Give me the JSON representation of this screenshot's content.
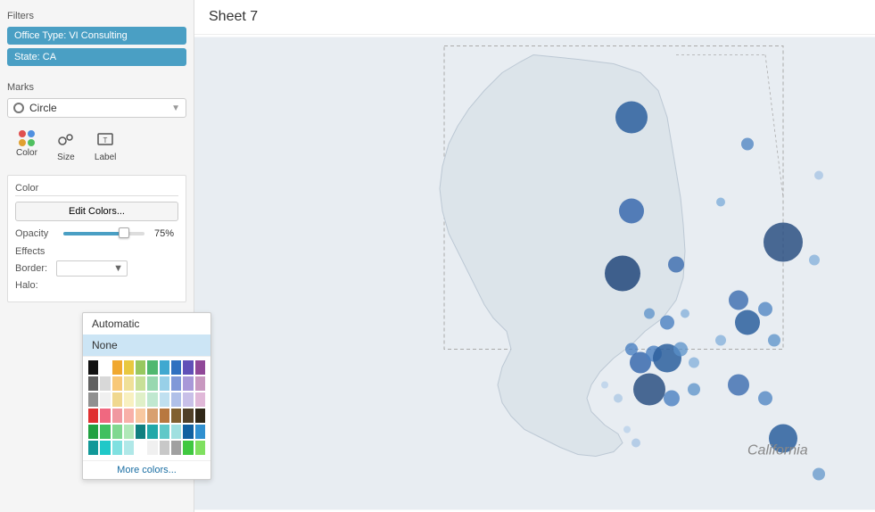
{
  "filters": {
    "label": "Filters",
    "chips": [
      {
        "id": "office-type",
        "text": "Office Type: VI Consulting"
      },
      {
        "id": "state",
        "text": "State: CA"
      }
    ]
  },
  "marks": {
    "label": "Marks",
    "dropdown": {
      "shape": "Circle"
    },
    "buttons": [
      {
        "id": "color",
        "label": "Color"
      },
      {
        "id": "size",
        "label": "Size"
      },
      {
        "id": "label",
        "label": "Label"
      }
    ]
  },
  "color_panel": {
    "title": "Color",
    "edit_button": "Edit Colors...",
    "opacity_label": "Opacity",
    "opacity_value": "75%",
    "effects_label": "Effects",
    "border_label": "Border:",
    "halo_label": "Halo:"
  },
  "halo_menu": {
    "items": [
      {
        "id": "automatic",
        "text": "Automatic"
      },
      {
        "id": "none",
        "text": "None",
        "selected": true
      }
    ],
    "more_colors": "More colors..."
  },
  "sheet": {
    "title": "Sheet 7"
  },
  "palette": {
    "rows": [
      [
        "#111111",
        "#ffffff",
        "#f0a830",
        "#e8c840",
        "#98c860",
        "#50b870",
        "#40a8d0",
        "#3070c0",
        "#6050b8",
        "#904898"
      ],
      [
        "#606060",
        "#d8d8d8",
        "#f8c878",
        "#f0e098",
        "#c8e098",
        "#98d8b0",
        "#98d0e8",
        "#8098d8",
        "#a898d8",
        "#c898c0"
      ],
      [
        "#909090",
        "#f0f0f0",
        "#f0d890",
        "#f8f0c0",
        "#e0f0c8",
        "#c0e8d0",
        "#c0e0f0",
        "#b0c0e8",
        "#c8c0e8",
        "#e0b8d8"
      ],
      [
        "#e03030",
        "#f06880",
        "#f098a0",
        "#f8b0a8",
        "#f8c8a0",
        "#d8a070",
        "#b87840",
        "#806030",
        "#504028",
        "#302818"
      ],
      [
        "#20a040",
        "#40c060",
        "#80d890",
        "#b0e8b8",
        "#108080",
        "#20a8a8",
        "#60c8c8",
        "#a0e0e0",
        "#1060a0",
        "#3090d0"
      ],
      [
        "#109898",
        "#20c8c8",
        "#80e0e0",
        "#b0e8e8",
        "#ffffff",
        "#f0f0f0",
        "#c8c8c8",
        "#a0a0a0",
        "#40c840",
        "#80e060"
      ]
    ]
  }
}
